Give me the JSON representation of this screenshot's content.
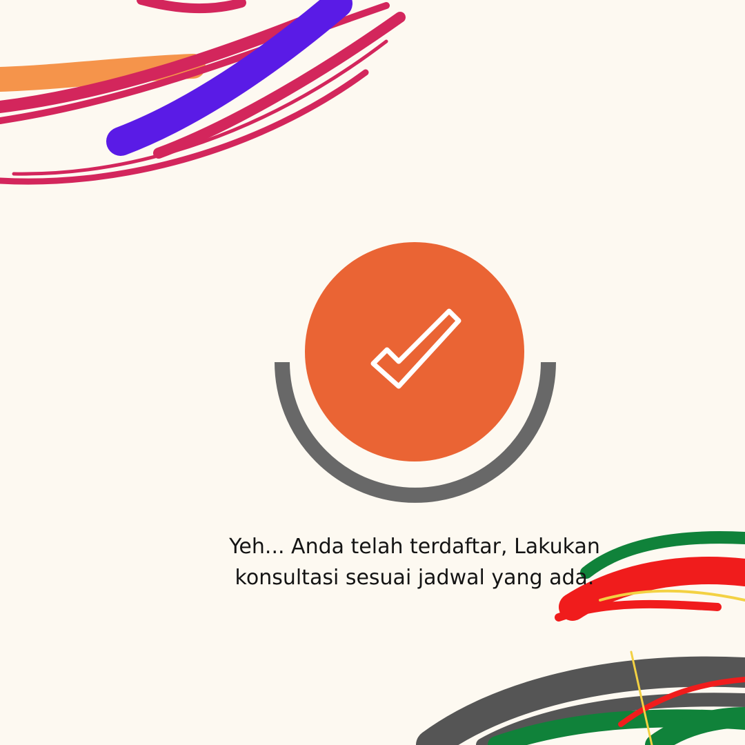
{
  "colors": {
    "background": "#FDF9F1",
    "accent": "#EA6434",
    "ring": "#686868",
    "check": "#FFFFFF",
    "text": "#141414",
    "brush_orange": "#F5944B",
    "brush_crimson": "#D3265C",
    "brush_violet": "#5A1BE6",
    "brush_green": "#10823A",
    "brush_red": "#F01C1C",
    "brush_yellow": "#F3D143",
    "brush_gray": "#555555"
  },
  "icons": {
    "status": "check-icon",
    "ring": "half-ring"
  },
  "message": {
    "line1": "Yeh... Anda telah terdaftar, Lakukan",
    "line2": "konsultasi sesuai jadwal yang ada."
  }
}
